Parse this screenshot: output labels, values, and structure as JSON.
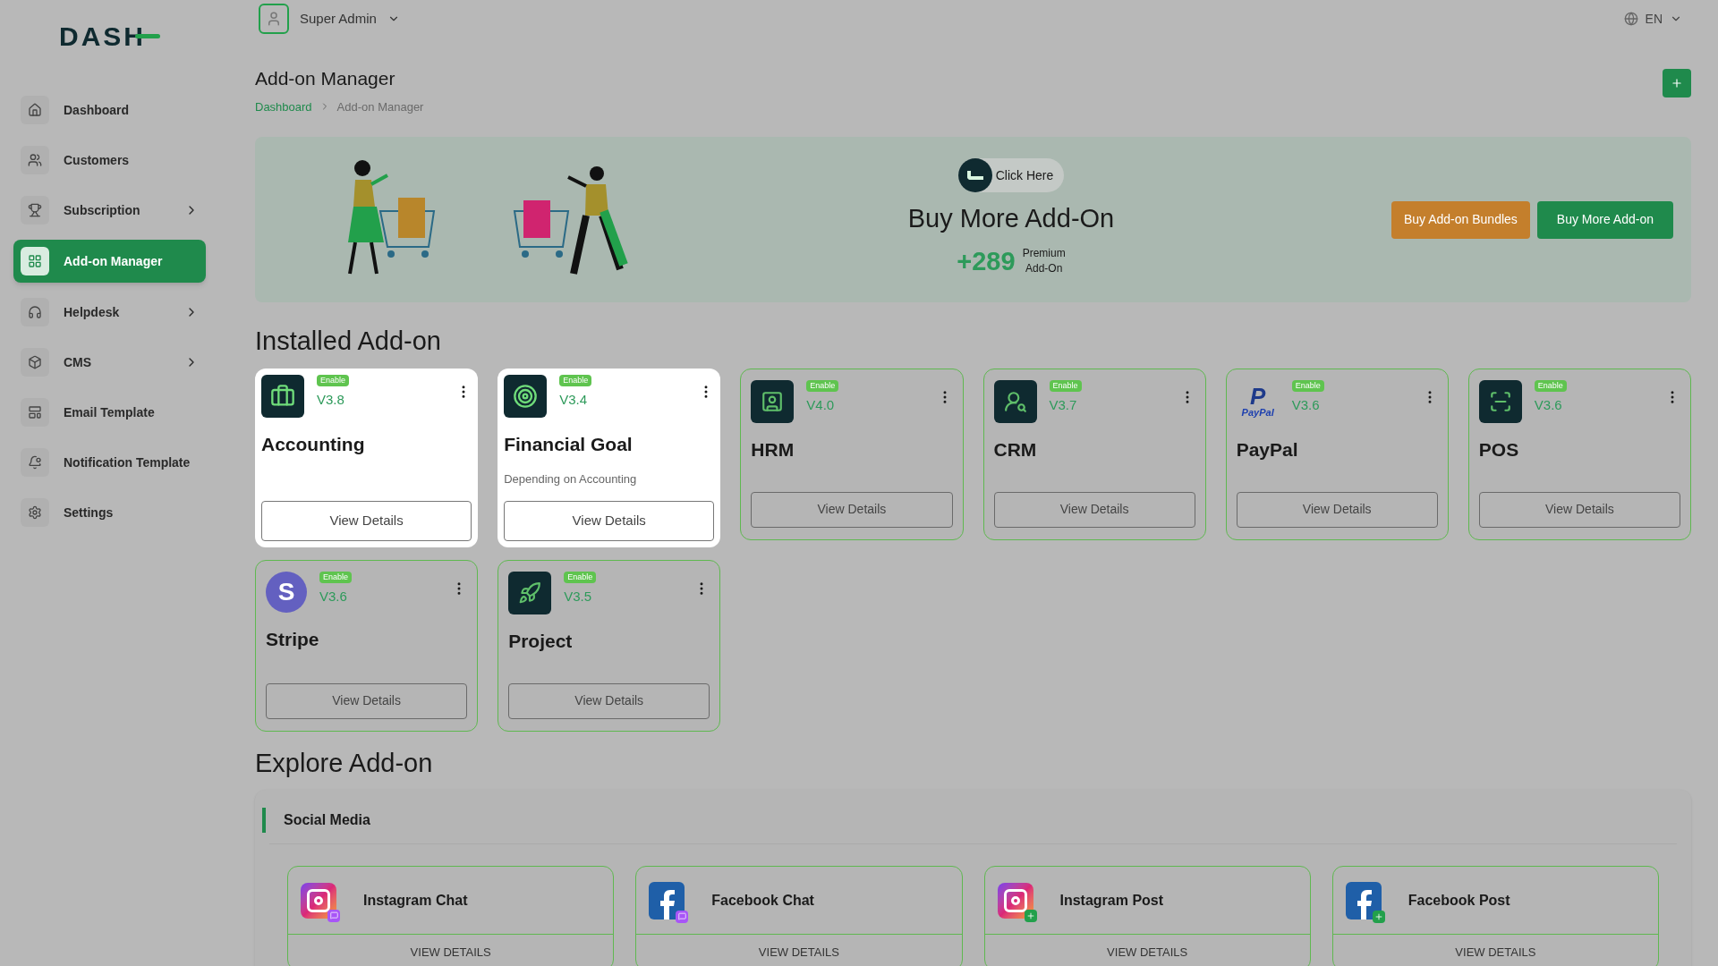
{
  "logo": {
    "text": "DASH"
  },
  "sidebar": {
    "items": [
      {
        "label": "Dashboard",
        "selected": false,
        "expandable": false
      },
      {
        "label": "Customers",
        "selected": false,
        "expandable": false
      },
      {
        "label": "Subscription",
        "selected": false,
        "expandable": true
      },
      {
        "label": "Add-on Manager",
        "selected": true,
        "expandable": false
      },
      {
        "label": "Helpdesk",
        "selected": false,
        "expandable": true
      },
      {
        "label": "CMS",
        "selected": false,
        "expandable": true
      },
      {
        "label": "Email Template",
        "selected": false,
        "expandable": false
      },
      {
        "label": "Notification Template",
        "selected": false,
        "expandable": false
      },
      {
        "label": "Settings",
        "selected": false,
        "expandable": false
      }
    ]
  },
  "topbar": {
    "user": "Super Admin",
    "language": "EN"
  },
  "page": {
    "title": "Add-on Manager",
    "breadcrumb": [
      "Dashboard",
      "Add-on Manager"
    ]
  },
  "banner": {
    "badge": "Click Here",
    "title": "Buy More Add-On",
    "count": "+289",
    "count_label_1": "Premium",
    "count_label_2": "Add-On",
    "buttons": [
      {
        "label": "Buy Add-on Bundles",
        "kind": "secondary"
      },
      {
        "label": "Buy More Add-on",
        "kind": "primary"
      }
    ]
  },
  "installed": {
    "title": "Installed Add-on",
    "items": [
      {
        "name": "Accounting",
        "version": "V3.8",
        "status": "Enable",
        "highlighted": true,
        "button": "View Details"
      },
      {
        "name": "Financial Goal",
        "version": "V3.4",
        "status": "Enable",
        "highlighted": true,
        "note": "Depending on Accounting",
        "button": "View Details"
      },
      {
        "name": "HRM",
        "version": "V4.0",
        "status": "Enable",
        "highlighted": false,
        "button": "View Details"
      },
      {
        "name": "CRM",
        "version": "V3.7",
        "status": "Enable",
        "highlighted": false,
        "button": "View Details"
      },
      {
        "name": "PayPal",
        "version": "V3.6",
        "status": "Enable",
        "logo_mark": "P",
        "logo_text": "PayPal",
        "highlighted": false,
        "button": "View Details"
      },
      {
        "name": "POS",
        "version": "V3.6",
        "status": "Enable",
        "highlighted": false,
        "button": "View Details"
      },
      {
        "name": "Stripe",
        "version": "V3.6",
        "status": "Enable",
        "logo_mark": "S",
        "highlighted": false,
        "button": "View Details"
      },
      {
        "name": "Project",
        "version": "V3.5",
        "status": "Enable",
        "highlighted": false,
        "button": "View Details"
      }
    ]
  },
  "explore": {
    "title": "Explore Add-on",
    "category": "Social Media",
    "items": [
      {
        "name": "Instagram Chat",
        "button": "VIEW DETAILS"
      },
      {
        "name": "Facebook Chat",
        "button": "VIEW DETAILS"
      },
      {
        "name": "Instagram Post",
        "button": "VIEW DETAILS"
      },
      {
        "name": "Facebook Post",
        "button": "VIEW DETAILS"
      }
    ]
  }
}
